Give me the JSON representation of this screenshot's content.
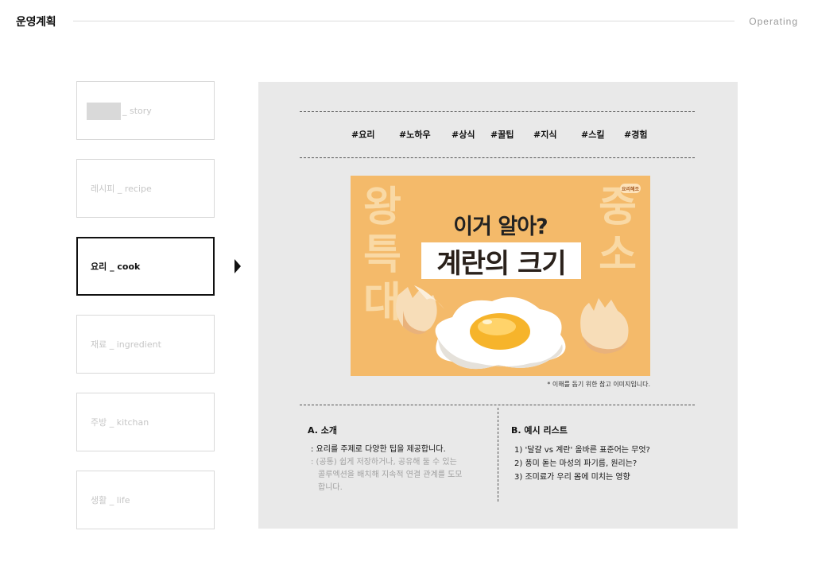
{
  "header": {
    "title": "운영계획",
    "right": "Operating"
  },
  "menu": {
    "items": [
      {
        "label": "_ story",
        "state": "normal",
        "has_placeholder": true
      },
      {
        "label": "레시피 _ recipe",
        "state": "normal"
      },
      {
        "label": "요리 _ cook",
        "state": "active"
      },
      {
        "label": "재료 _ ingredient",
        "state": "normal"
      },
      {
        "label": "주방 _ kitchan",
        "state": "normal"
      },
      {
        "label": "생활 _ life",
        "state": "normal"
      }
    ]
  },
  "tags": [
    "#요리",
    "#노하우",
    "#상식",
    "#꿀팁",
    "#지식",
    "#스킬",
    "#경험"
  ],
  "hero": {
    "subtitle": "이거 알아?",
    "title": "계란의 크기",
    "side_left": [
      "왕",
      "특",
      "대"
    ],
    "side_right": [
      "중",
      "소"
    ],
    "logo": "요리해조",
    "caption": "* 이해를 돕기 위한 참고 이미지입니다."
  },
  "section_a": {
    "title": "A. 소개",
    "line1": ": 요리를 주제로 다양한 팁을 제공합니다.",
    "line2_lines": [
      ": (공통) 쉽게 저장하거나, 공유해 둘 수 있는",
      "  콜루엑션을 배치해 지속적 연결 관계를 도모",
      "  합니다."
    ]
  },
  "section_b": {
    "title": "B. 예시 리스트",
    "items": [
      "1) '달걀 vs 계란' 올바른 표준어는 무엇?",
      "2) 풍미 돋는 마성의 파기름, 원리는?",
      "3) 조미료가 우리 몸에 미치는 영향"
    ]
  },
  "colors": {
    "hero_bg": "#f4ba6a",
    "panel_bg": "#e9e9e9",
    "active_border": "#111111"
  }
}
